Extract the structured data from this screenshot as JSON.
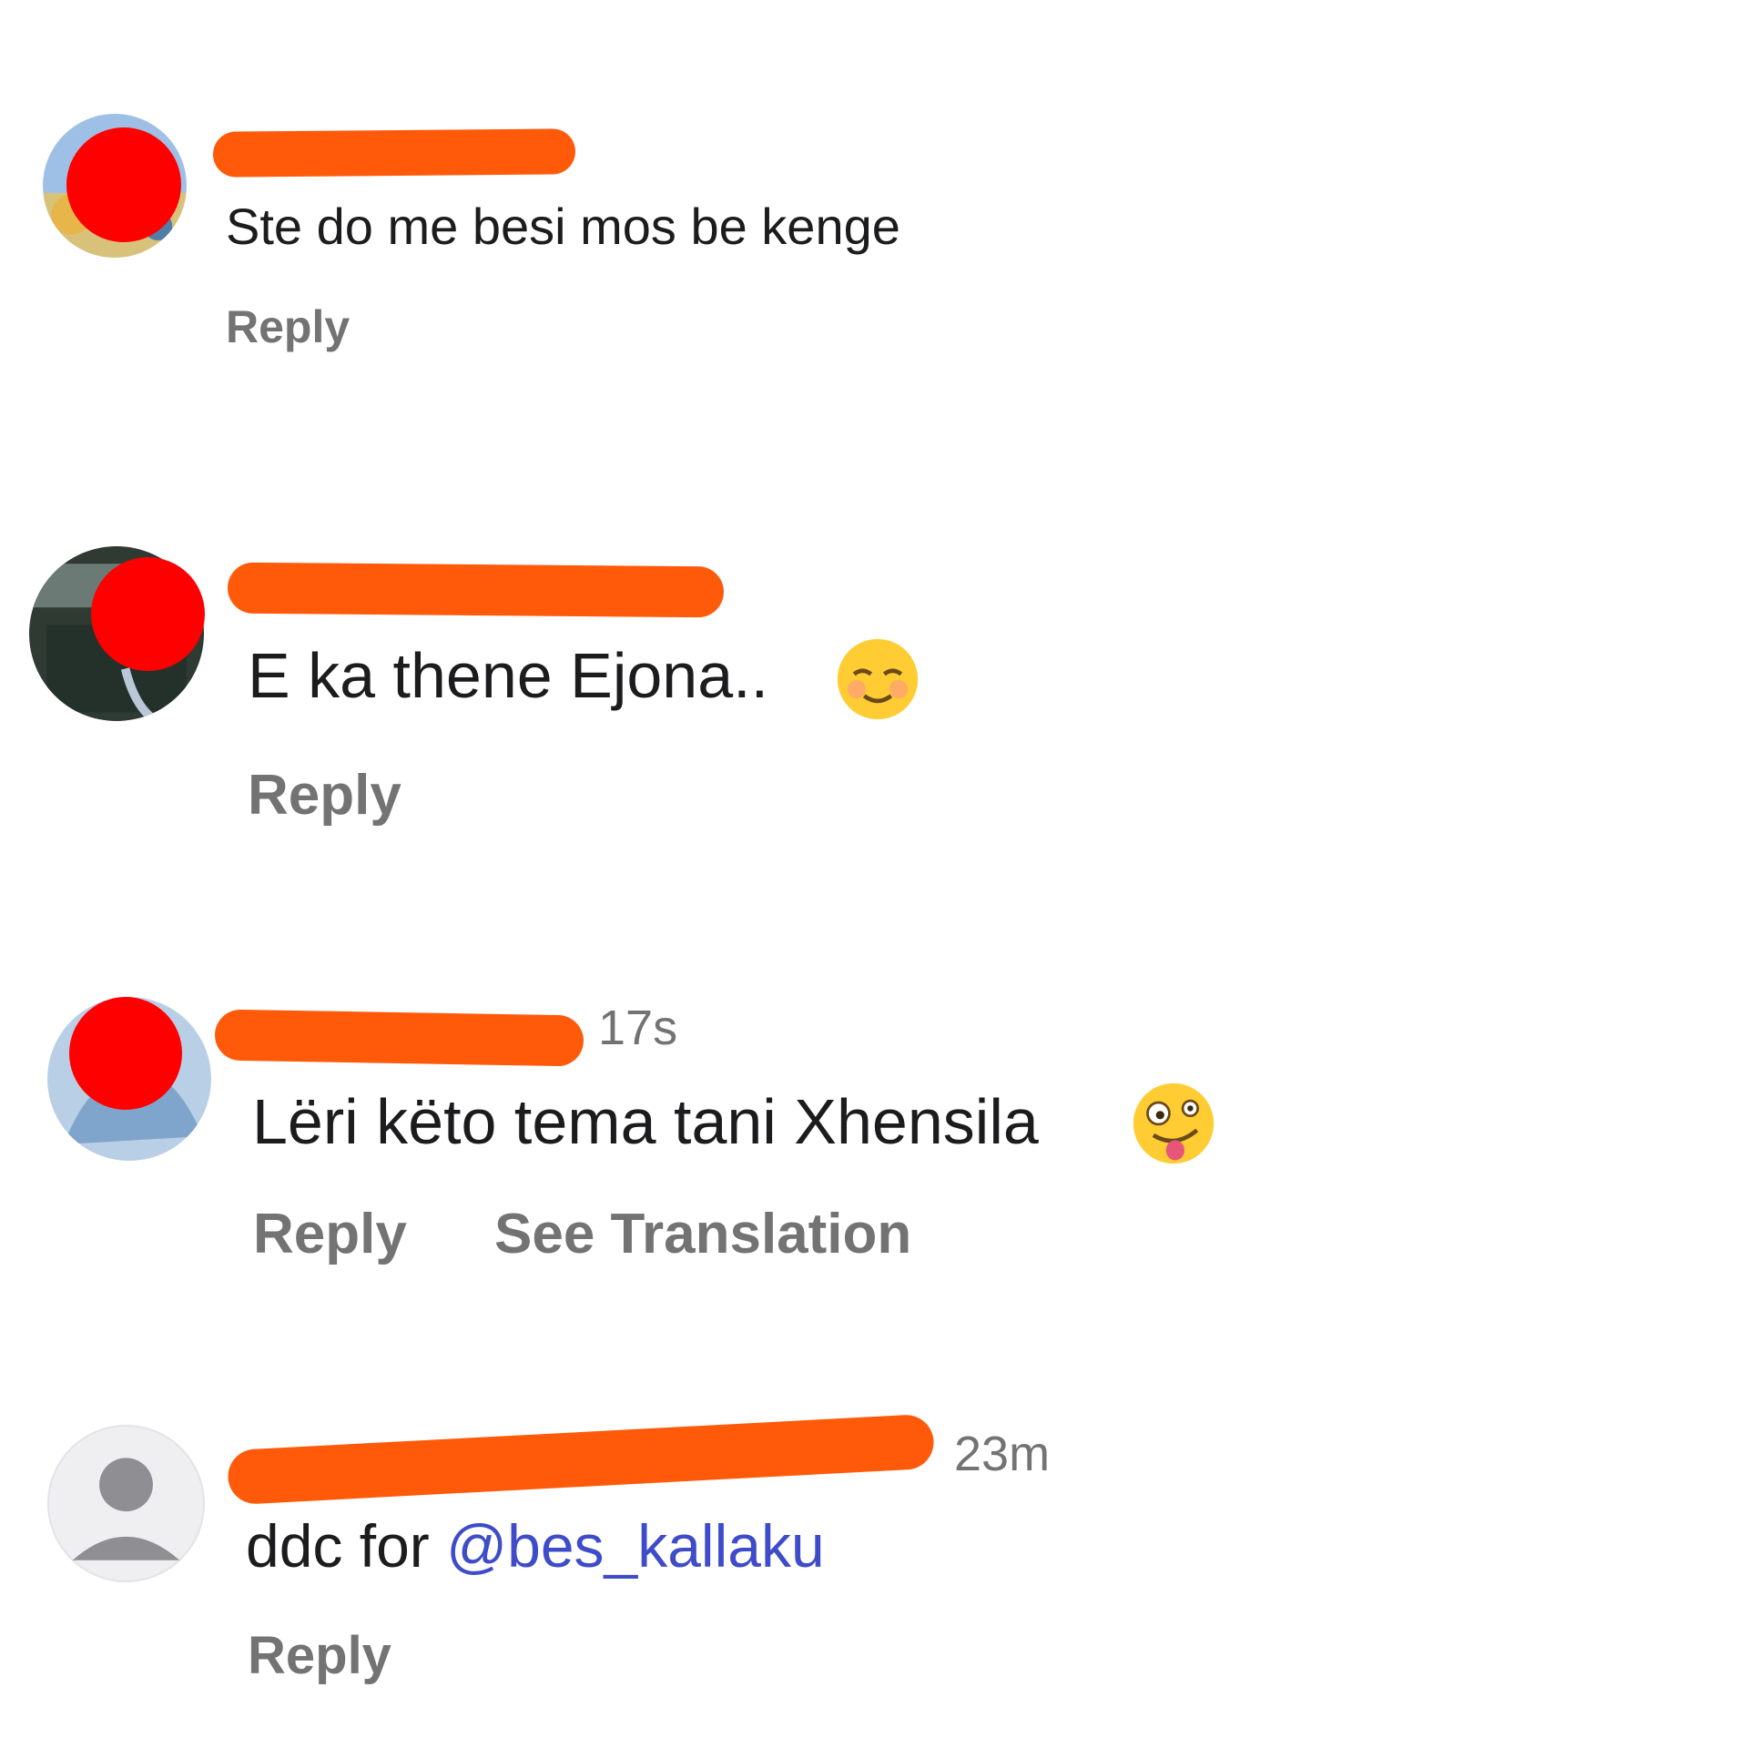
{
  "comments": [
    {
      "username": "",
      "time": "",
      "text": "Ste do me besi mos be kenge",
      "reply_label": "Reply"
    },
    {
      "username": "",
      "time": "",
      "text": "E ka thene Ejona..",
      "emoji": "smiling-face-with-smiling-eyes",
      "reply_label": "Reply"
    },
    {
      "username": "",
      "time": "17s",
      "text": "Lëri këto tema tani Xhensila",
      "emoji": "zany-face",
      "reply_label": "Reply",
      "translate_label": "See Translation"
    },
    {
      "username": "",
      "time": "23m",
      "text_prefix": "ddc for ",
      "mention": "@bes_kallaku",
      "reply_label": "Reply"
    }
  ],
  "colors": {
    "redaction_bar": "#ff5a0a",
    "redaction_dot": "#ff0000",
    "secondary_text": "#737373",
    "mention": "#3e4cc9",
    "primary_text": "#1c1c1e"
  }
}
